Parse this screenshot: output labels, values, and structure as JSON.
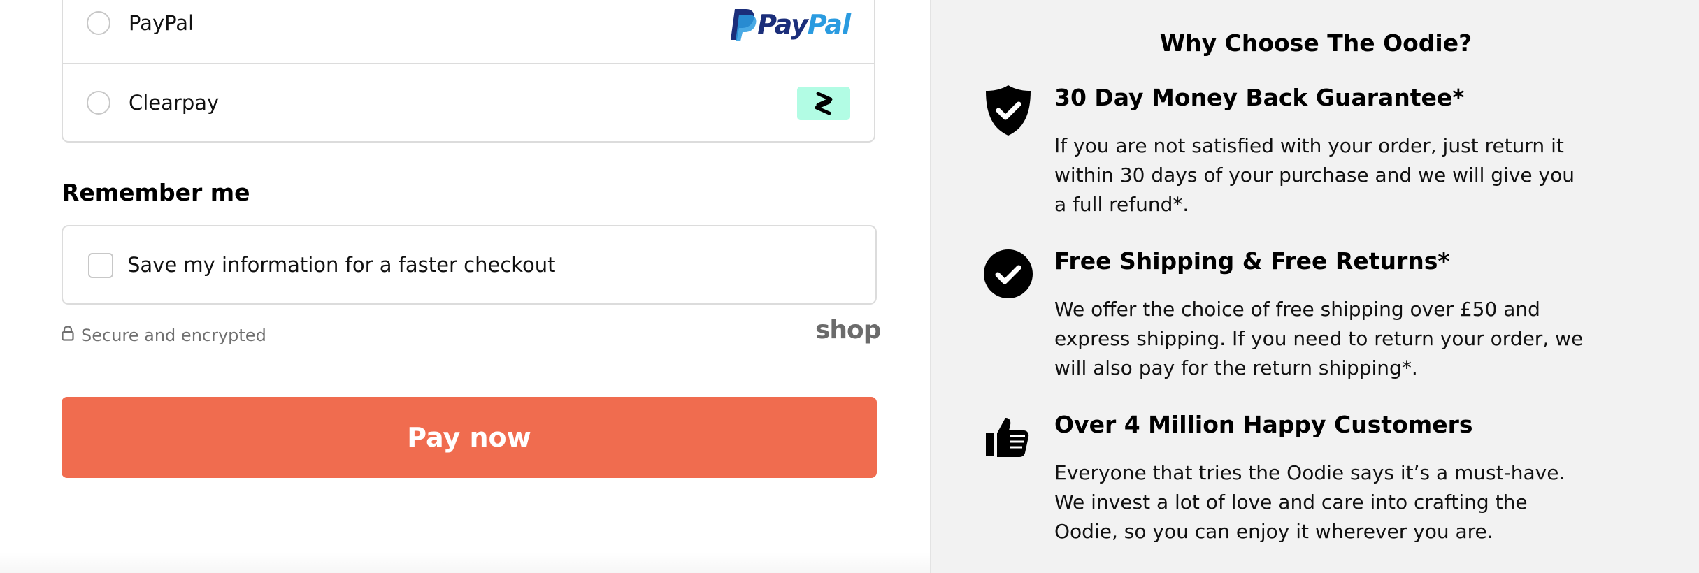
{
  "payment": {
    "options": [
      {
        "label": "PayPal",
        "logo_parts": [
          "Pay",
          "Pal"
        ],
        "logo_icon": "paypal-logo"
      },
      {
        "label": "Clearpay",
        "logo_icon": "clearpay-logo"
      }
    ]
  },
  "remember": {
    "title": "Remember me",
    "checkbox_label": "Save my information for a faster checkout"
  },
  "secure": {
    "text": "Secure and encrypted",
    "icon": "lock-icon",
    "shop_logo": "shop"
  },
  "pay_button": {
    "label": "Pay now"
  },
  "why": {
    "title": "Why Choose The Oodie?",
    "features": [
      {
        "icon": "shield-check-icon",
        "heading": "30 Day Money Back Guarantee*",
        "body": "If you are not satisfied with your order, just return it within 30 days of your purchase and we will give you a full refund*."
      },
      {
        "icon": "check-circle-icon",
        "heading": "Free Shipping & Free Returns*",
        "body": "We offer the choice of free shipping over £50 and express shipping. If you need to return your order, we will also pay for the return shipping*."
      },
      {
        "icon": "thumbs-up-icon",
        "heading": "Over 4 Million Happy Customers",
        "body": "Everyone that tries the Oodie says it’s a must-have. We invest a lot of love and care into crafting the Oodie, so you can enjoy it wherever you are."
      }
    ]
  },
  "colors": {
    "pay_button": "#f06c4f",
    "paypal_dark": "#1b2e7a",
    "paypal_light": "#2a9be0",
    "clearpay_mint": "#b2fce4",
    "sidebar_bg": "#f2f2f2"
  }
}
